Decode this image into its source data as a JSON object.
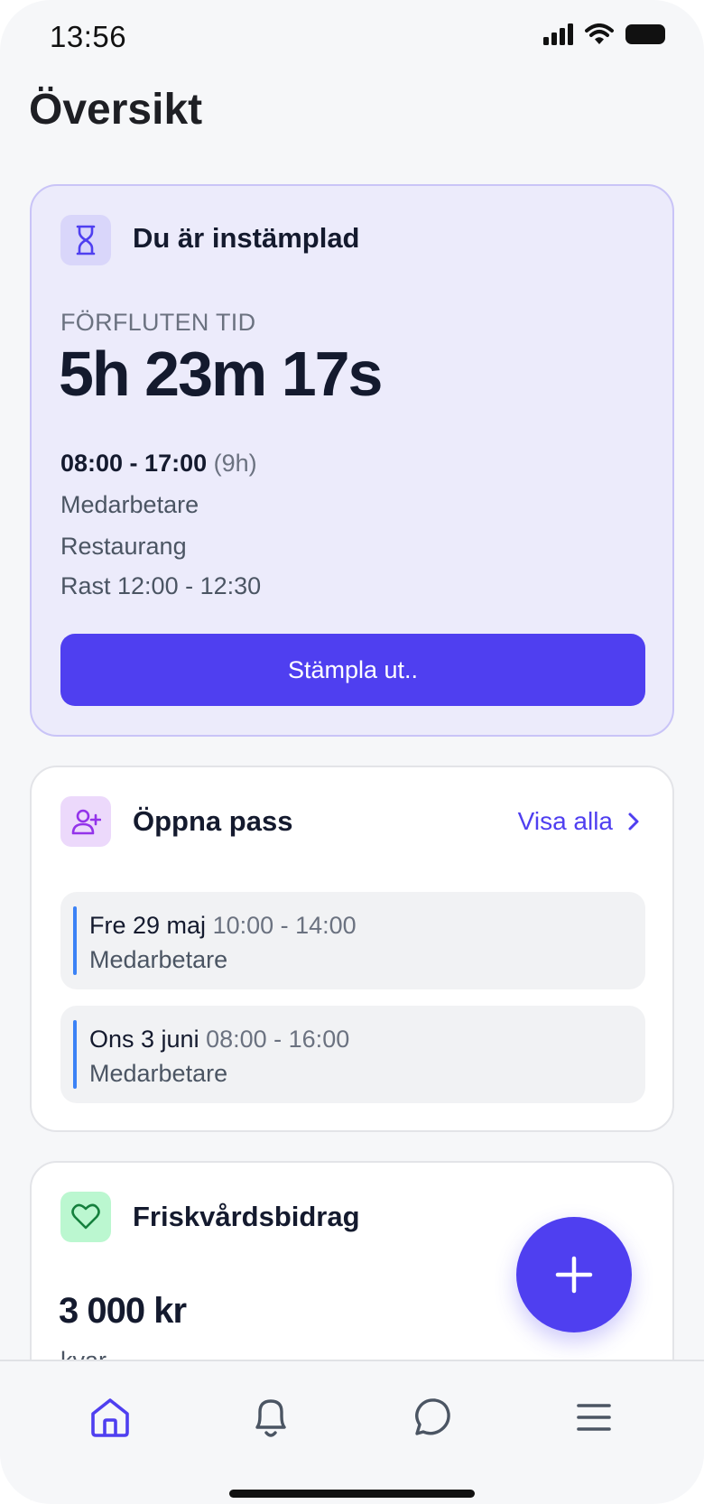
{
  "status_bar": {
    "time": "13:56"
  },
  "page": {
    "title": "Översikt"
  },
  "clock_card": {
    "title": "Du är instämplad",
    "elapsed_label": "FÖRFLUTEN TID",
    "elapsed_value": "5h 23m 17s",
    "shift_time": "08:00 - 17:00",
    "shift_duration": "(9h)",
    "role": "Medarbetare",
    "department": "Restaurang",
    "break": "Rast 12:00 - 12:30",
    "button_label": "Stämpla ut.."
  },
  "open_shifts": {
    "title": "Öppna pass",
    "view_all_label": "Visa alla",
    "items": [
      {
        "date": "Fre 29 maj",
        "time": "10:00 - 14:00",
        "role": "Medarbetare"
      },
      {
        "date": "Ons 3 juni",
        "time": "08:00 - 16:00",
        "role": "Medarbetare"
      }
    ]
  },
  "health_card": {
    "title": "Friskvårdsbidrag",
    "amount": "3 000 kr",
    "sub": "kvar"
  },
  "tabbar": {
    "items": [
      "home-icon",
      "bell-icon",
      "chat-icon",
      "menu-icon"
    ],
    "active": "home-icon"
  },
  "colors": {
    "accent": "#4f3ff0",
    "clock_card_bg": "#ecebfb",
    "shift_marker": "#3b82f6",
    "health_icon_bg": "#bbf7d0"
  }
}
